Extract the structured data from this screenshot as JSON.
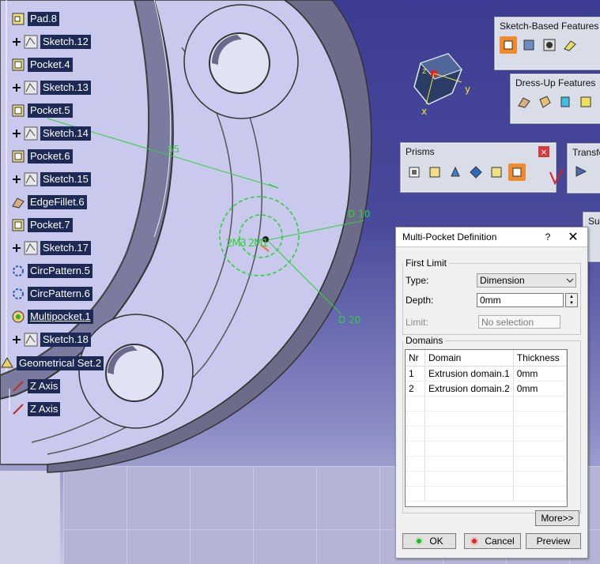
{
  "tree": {
    "items": [
      {
        "label": "Pad.8",
        "icon": "pad-icon",
        "expander": false
      },
      {
        "label": "Sketch.12",
        "icon": "sketch-icon",
        "expander": true
      },
      {
        "label": "Pocket.4",
        "icon": "pocket-icon",
        "expander": false
      },
      {
        "label": "Sketch.13",
        "icon": "sketch-icon",
        "expander": true
      },
      {
        "label": "Pocket.5",
        "icon": "pocket-icon",
        "expander": false
      },
      {
        "label": "Sketch.14",
        "icon": "sketch-icon",
        "expander": true
      },
      {
        "label": "Pocket.6",
        "icon": "pocket-icon",
        "expander": false
      },
      {
        "label": "Sketch.15",
        "icon": "sketch-icon",
        "expander": true
      },
      {
        "label": "EdgeFillet.6",
        "icon": "edgefillet-icon",
        "expander": false
      },
      {
        "label": "Pocket.7",
        "icon": "pocket-icon",
        "expander": false
      },
      {
        "label": "Sketch.17",
        "icon": "sketch-icon",
        "expander": true
      },
      {
        "label": "CircPattern.5",
        "icon": "circpattern-icon",
        "expander": false
      },
      {
        "label": "CircPattern.6",
        "icon": "circpattern-icon",
        "expander": false
      },
      {
        "label": "Multipocket.1",
        "icon": "multipocket-icon",
        "expander": false
      },
      {
        "label": "Sketch.18",
        "icon": "sketch-icon",
        "expander": true
      },
      {
        "label": "Geometrical Set.2",
        "icon": "geometrical-set-icon",
        "expander": false
      },
      {
        "label": "Z Axis",
        "icon": "axis-line-icon",
        "expander": false
      },
      {
        "label": "Z Axis",
        "icon": "axis-line-icon",
        "expander": false
      }
    ]
  },
  "viewport": {
    "dimensions": {
      "d10": "D 10",
      "d20": "D 20",
      "s5": "55",
      "center_label": "2M3 2M1"
    },
    "compass": {
      "x_label": "x",
      "y_label": "y",
      "z_label": "z"
    }
  },
  "toolbars": {
    "sketch_based": {
      "title": "Sketch-Based Features"
    },
    "dress_up": {
      "title": "Dress-Up Features"
    },
    "prisms": {
      "title": "Prisms",
      "close": "×"
    },
    "transform": {
      "title": "Transfo"
    },
    "surface": {
      "title": "Su"
    }
  },
  "dialog": {
    "title": "Multi-Pocket Definition",
    "help": "?",
    "close": "✕",
    "first_limit": {
      "legend": "First Limit",
      "type_label": "Type:",
      "type_value": "Dimension",
      "depth_label": "Depth:",
      "depth_value": "0mm",
      "limit_label": "Limit:",
      "limit_value": "No selection"
    },
    "domains": {
      "legend": "Domains",
      "columns": [
        "Nr",
        "Domain",
        "Thickness"
      ],
      "rows": [
        {
          "nr": "1",
          "domain": "Extrusion domain.1",
          "thickness": "0mm"
        },
        {
          "nr": "2",
          "domain": "Extrusion domain.2",
          "thickness": "0mm"
        }
      ]
    },
    "more_button": "More>>",
    "ok_button": "OK",
    "cancel_button": "Cancel",
    "preview_button": "Preview"
  }
}
